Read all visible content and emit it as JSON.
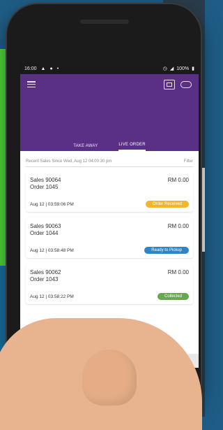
{
  "statusbar": {
    "time": "16:00",
    "icons_left": [
      "status-icon",
      "status-icon",
      "status-icon"
    ],
    "battery": "100%"
  },
  "header": {
    "tabs": [
      {
        "label": "TAKE AWAY",
        "active": false
      },
      {
        "label": "LIVE ORDER",
        "active": true
      }
    ]
  },
  "filter": {
    "caption": "Recent Sales Since Wed, Aug 12 04:00:30 pm",
    "action": "Filter"
  },
  "orders": [
    {
      "sales": "Sales 90064",
      "order": "Order 1045",
      "amount": "RM 0.00",
      "datetime": "Aug 12 | 03:59:06 PM",
      "status": "Order Received",
      "status_color": "#f2b52e"
    },
    {
      "sales": "Sales 90063",
      "order": "Order 1044",
      "amount": "RM 0.00",
      "datetime": "Aug 12 | 03:58:48 PM",
      "status": "Ready to Pickup",
      "status_color": "#2f84c5"
    },
    {
      "sales": "Sales 90062",
      "order": "Order 1043",
      "amount": "RM 0.00",
      "datetime": "Aug 12 | 03:58:22 PM",
      "status": "Collected",
      "status_color": "#6aa84f"
    }
  ],
  "navbar": {
    "back": "◁",
    "home": "○",
    "recent": "□"
  },
  "colors": {
    "appbar": "#5a2f86",
    "order_received": "#f2b52e",
    "ready_to_pickup": "#2f84c5",
    "collected": "#6aa84f"
  }
}
